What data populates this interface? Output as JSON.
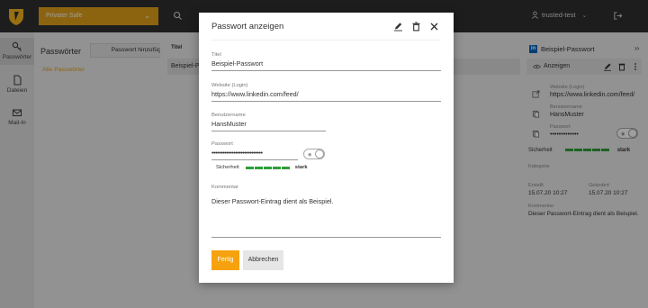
{
  "topbar": {
    "vault_name": "Privater Safe",
    "user_name": "trusted-test"
  },
  "nav": {
    "items": [
      {
        "label": "Passwörter",
        "icon": "key-icon"
      },
      {
        "label": "Dateien",
        "icon": "file-icon"
      },
      {
        "label": "Mail-In",
        "icon": "mail-icon"
      }
    ]
  },
  "list": {
    "title": "Passwörter",
    "add_label": "Passwort hinzufügen",
    "all_link": "Alle Passwörter",
    "column_title": "Titel",
    "row_title": "Beispiel-Pa"
  },
  "detail": {
    "title": "Beispiel-Passwort",
    "show_label": "Anzeigen",
    "website_label": "Website (Login)",
    "website_value": "https://www.linkedin.com/feed/",
    "username_label": "Benutzername",
    "username_value": "HansMuster",
    "password_label": "Passwort",
    "password_value": "•••••••••••••",
    "strength_label": "Sicherheit",
    "strength_value": "stark",
    "category_label": "Kategorie",
    "created_label": "Erstellt",
    "created_value": "15.07.20 10:27",
    "changed_label": "Geändert",
    "changed_value": "15.07.20 10:27",
    "comment_label": "Kommentar",
    "comment_value": "Dieser Passwort-Eintrag dient als Beispiel."
  },
  "modal": {
    "title": "Passwort anzeigen",
    "title_label": "Titel",
    "title_value": "Beispiel-Passwort",
    "website_label": "Website (Login)",
    "website_value": "https://www.linkedin.com/feed/",
    "username_label": "Benutzername",
    "username_value": "HansMuster",
    "password_label": "Passwort",
    "password_value": "••••••••••••••••••••••••••••",
    "strength_label": "Sicherheit",
    "strength_value": "stark",
    "comment_label": "Kommentar",
    "comment_value": "Dieser Passwort-Eintrag dient als Beispiel.",
    "done_label": "Fertig",
    "cancel_label": "Abbrechen"
  },
  "colors": {
    "accent": "#f6a20e",
    "strength": "#2e9e3a",
    "topbar": "#2f2f2f"
  }
}
